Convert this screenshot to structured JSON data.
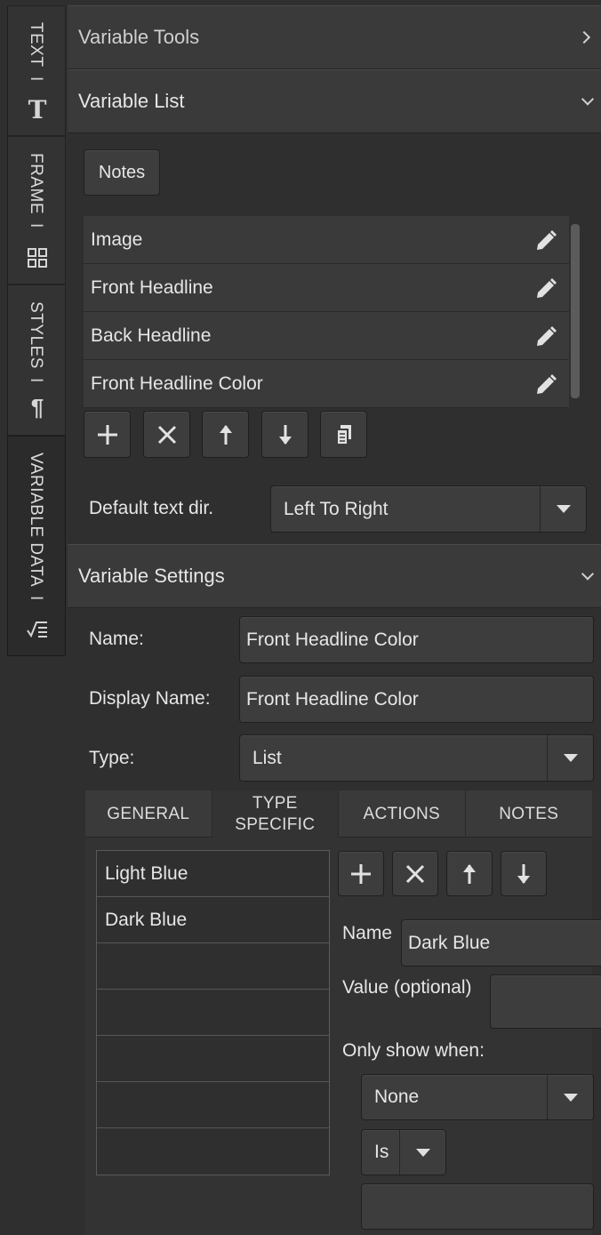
{
  "sidebar": {
    "tabs": [
      {
        "label": "TEXT",
        "icon": "text-T-icon"
      },
      {
        "label": "FRAME",
        "icon": "grid-icon"
      },
      {
        "label": "STYLES",
        "icon": "pilcrow-icon"
      },
      {
        "label": "VARIABLE DATA",
        "icon": "variable-data-icon"
      }
    ],
    "separator": "I",
    "text_glyph": "T",
    "pilcrow_glyph": "¶"
  },
  "variable_tools": {
    "title": "Variable Tools"
  },
  "variable_list": {
    "title": "Variable List",
    "notes_button": "Notes",
    "items": [
      {
        "label": "Image"
      },
      {
        "label": "Front Headline"
      },
      {
        "label": "Back Headline"
      },
      {
        "label": "Front Headline Color"
      }
    ],
    "toolbar": [
      "add",
      "delete",
      "move-up",
      "move-down",
      "copy"
    ],
    "default_text_dir_label": "Default text dir.",
    "default_text_dir_value": "Left To Right"
  },
  "variable_settings": {
    "title": "Variable Settings",
    "name_label": "Name:",
    "name_value": "Front Headline Color",
    "display_name_label": "Display Name:",
    "display_name_value": "Front Headline Color",
    "type_label": "Type:",
    "type_value": "List",
    "tabs": [
      {
        "label": "GENERAL"
      },
      {
        "label": "TYPE SPECIFIC"
      },
      {
        "label": "ACTIONS"
      },
      {
        "label": "NOTES"
      }
    ],
    "list_options": [
      "Light Blue",
      "Dark Blue",
      "",
      "",
      "",
      "",
      ""
    ],
    "option_name_label": "Name",
    "option_name_value": "Dark Blue",
    "option_value_label": "Value (optional)",
    "option_value_value": "",
    "only_show_when_label": "Only show when:",
    "only_show_when_value": "None",
    "condition_operator": "Is",
    "condition_value": ""
  },
  "colors": {
    "background": "#2f2f2f",
    "header": "#3a3a3a",
    "control": "#3d3d3d",
    "text": "#e6e6e6"
  }
}
